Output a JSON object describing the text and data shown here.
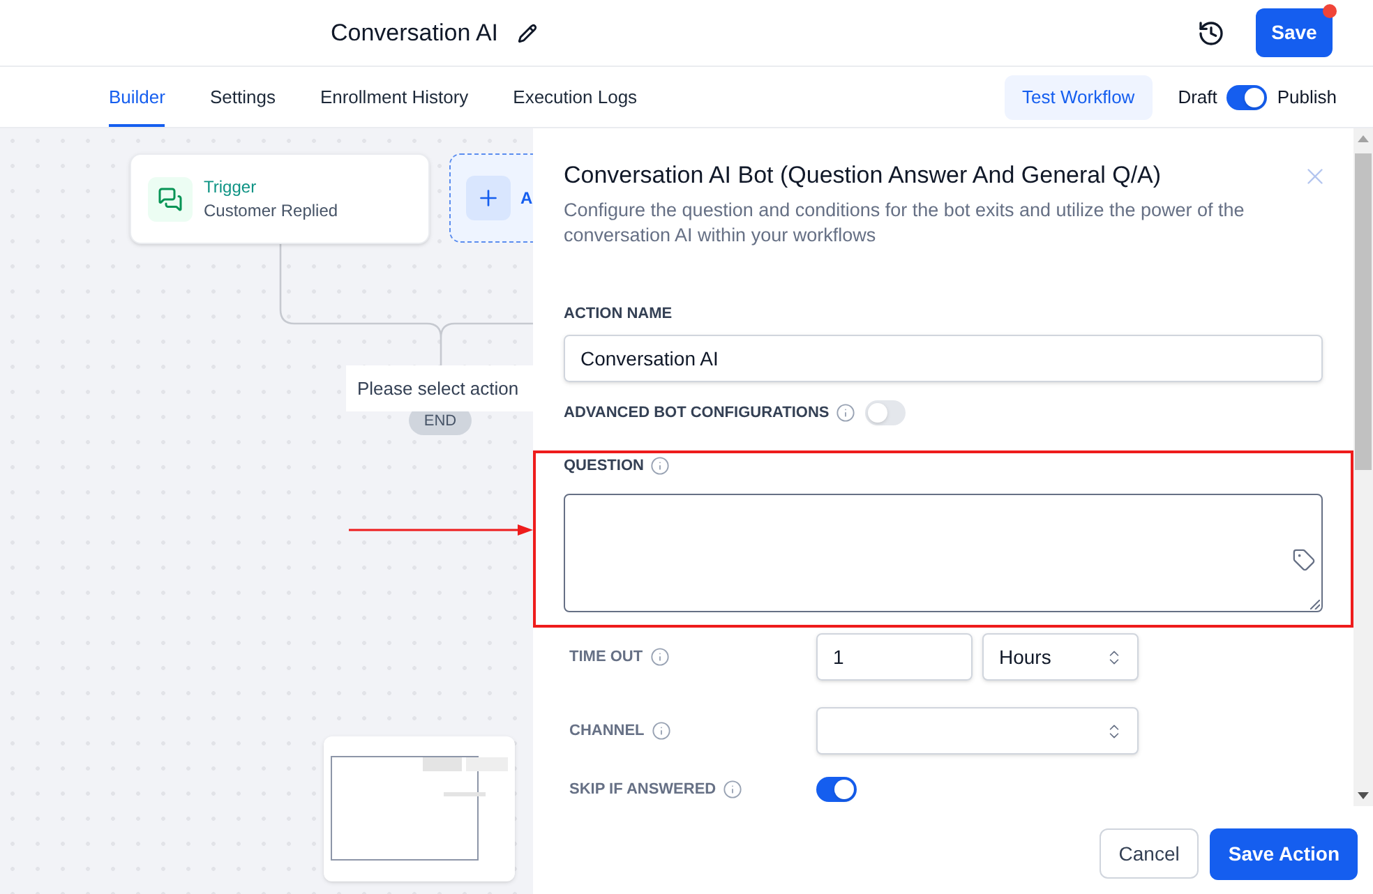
{
  "header": {
    "title": "Conversation AI",
    "save_label": "Save",
    "notification": true
  },
  "tabs": [
    {
      "label": "Builder",
      "selected": true
    },
    {
      "label": "Settings",
      "selected": false
    },
    {
      "label": "Enrollment History",
      "selected": false
    },
    {
      "label": "Execution Logs",
      "selected": false
    }
  ],
  "toolbar": {
    "test_button": "Test Workflow",
    "draft_label": "Draft",
    "publish_label": "Publish",
    "published": true
  },
  "canvas": {
    "trigger": {
      "title": "Trigger",
      "subtitle": "Customer Replied"
    },
    "add_action_label": "A",
    "pending_action": "Please select action",
    "end_label": "END"
  },
  "panel": {
    "title": "Conversation AI Bot (Question Answer And General Q/A)",
    "description": "Configure the question and conditions for the bot exits and utilize the power of the conversation AI within your workflows",
    "fields": [
      {
        "kind": "text_input",
        "label": "ACTION NAME",
        "info": false,
        "value": "Conversation AI"
      },
      {
        "kind": "switch",
        "label": "ADVANCED BOT CONFIGURATIONS",
        "info": true,
        "on": false
      },
      {
        "kind": "text_area",
        "label": "QUESTION",
        "info": true,
        "highlighted": true
      },
      {
        "kind": "timeout_row",
        "label": "TIME OUT",
        "info": true,
        "value": "1",
        "unit": "Hours"
      },
      {
        "kind": "select_row",
        "label": "CHANNEL",
        "info": true
      },
      {
        "kind": "switch_row",
        "label": "SKIP IF ANSWERED",
        "info": true,
        "on": true
      }
    ],
    "cancel_button": "Cancel",
    "save_button": "Save Action"
  }
}
